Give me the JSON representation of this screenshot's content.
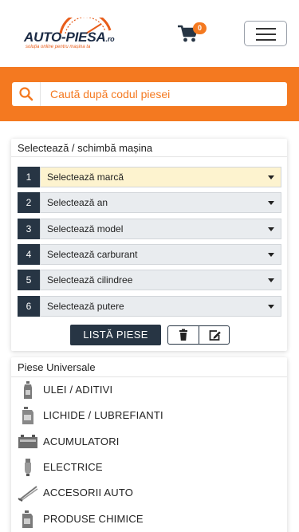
{
  "header": {
    "logo_name": "AUTO-PIESA",
    "logo_suffix": ".ro",
    "logo_tagline": "soluția online pentru mașina ta",
    "cart_count": "0"
  },
  "search": {
    "placeholder": "Caută după codul piesei"
  },
  "car_selector": {
    "title": "Selectează / schimbă mașina",
    "steps": [
      {
        "num": "1",
        "label": "Selectează marcă"
      },
      {
        "num": "2",
        "label": "Selectează an"
      },
      {
        "num": "3",
        "label": "Selectează model"
      },
      {
        "num": "4",
        "label": "Selectează carburant"
      },
      {
        "num": "5",
        "label": "Selectează cilindree"
      },
      {
        "num": "6",
        "label": "Selectează putere"
      }
    ],
    "list_button": "LISTĂ PIESE"
  },
  "universal": {
    "title": "Piese Universale",
    "items": [
      {
        "label": "ULEI / ADITIVI",
        "icon": "oil-bottle-icon"
      },
      {
        "label": "LICHIDE / LUBREFIANTI",
        "icon": "fluid-canister-icon"
      },
      {
        "label": "ACUMULATORI",
        "icon": "battery-icon"
      },
      {
        "label": "ELECTRICE",
        "icon": "bulb-icon"
      },
      {
        "label": "ACCESORII AUTO",
        "icon": "wiper-icon"
      },
      {
        "label": "PRODUSE CHIMICE",
        "icon": "chemical-can-icon"
      }
    ]
  },
  "colors": {
    "accent": "#f47920",
    "dark": "#273544",
    "active_select": "#fdf3cf"
  }
}
